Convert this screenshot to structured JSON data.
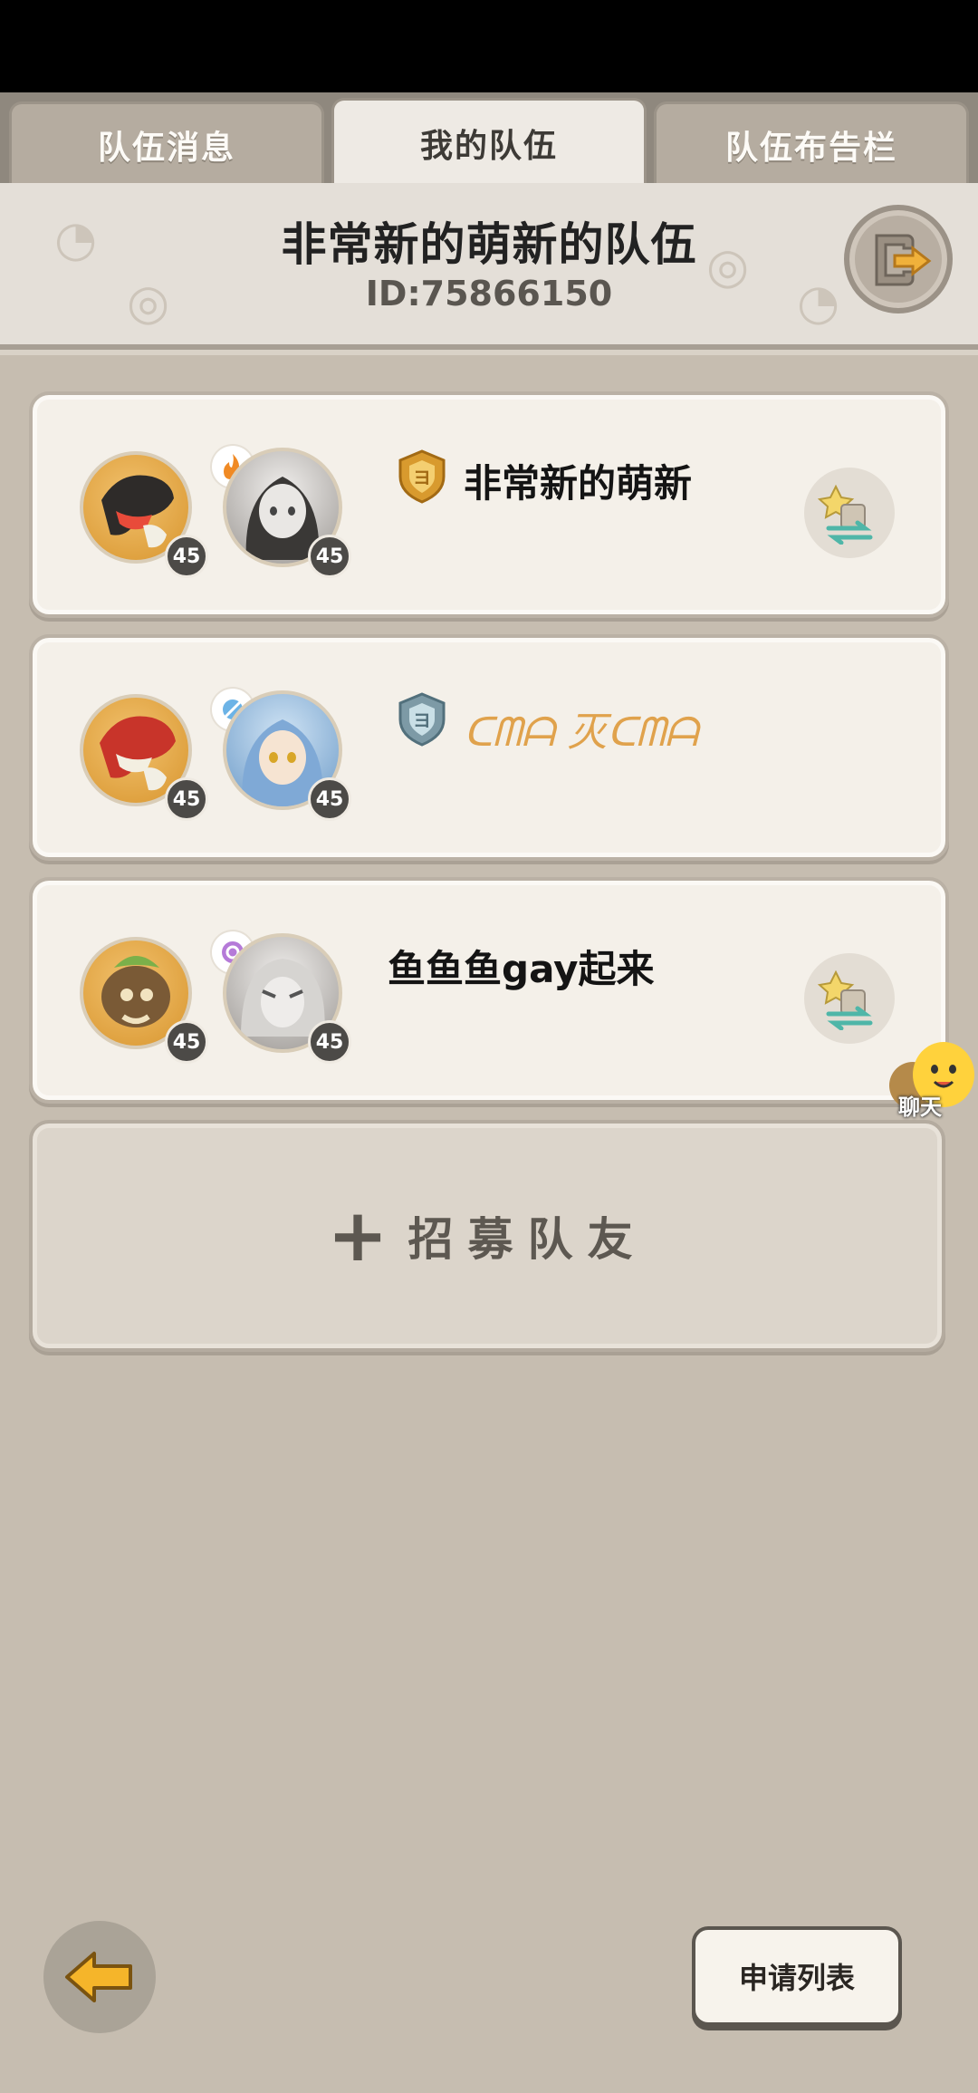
{
  "tabs": [
    {
      "label": "队伍消息",
      "active": false
    },
    {
      "label": "我的队伍",
      "active": true
    },
    {
      "label": "队伍布告栏",
      "active": false
    }
  ],
  "team": {
    "name": "非常新的萌新的队伍",
    "id_text": "ID:75866150"
  },
  "members": [
    {
      "name": "非常新的萌新",
      "pet_level": "45",
      "player_level": "45",
      "element": "fire",
      "shield": "gold",
      "name_style": "plain"
    },
    {
      "name": "ᑕᗰᗩ 灭ᑕᗰᗩ",
      "pet_level": "45",
      "player_level": "45",
      "element": "ice",
      "shield": "silver",
      "name_style": "cursive"
    },
    {
      "name": "鱼鱼鱼gay起来",
      "pet_level": "45",
      "player_level": "45",
      "element": "psychic",
      "shield": "none",
      "name_style": "plain"
    }
  ],
  "recruit": {
    "plus": "+",
    "label": "招募队友"
  },
  "chat": {
    "label": "聊天"
  },
  "apply_list": {
    "label": "申请列表"
  },
  "colors": {
    "accent_gold": "#e8a63c",
    "background": "#c6bdb0",
    "card": "#f4f0e9"
  },
  "icons": [
    "exit-team-icon",
    "swap-member-icon",
    "back-arrow-icon",
    "chat-icon",
    "fire-element-icon",
    "ice-element-icon",
    "psychic-element-icon"
  ]
}
